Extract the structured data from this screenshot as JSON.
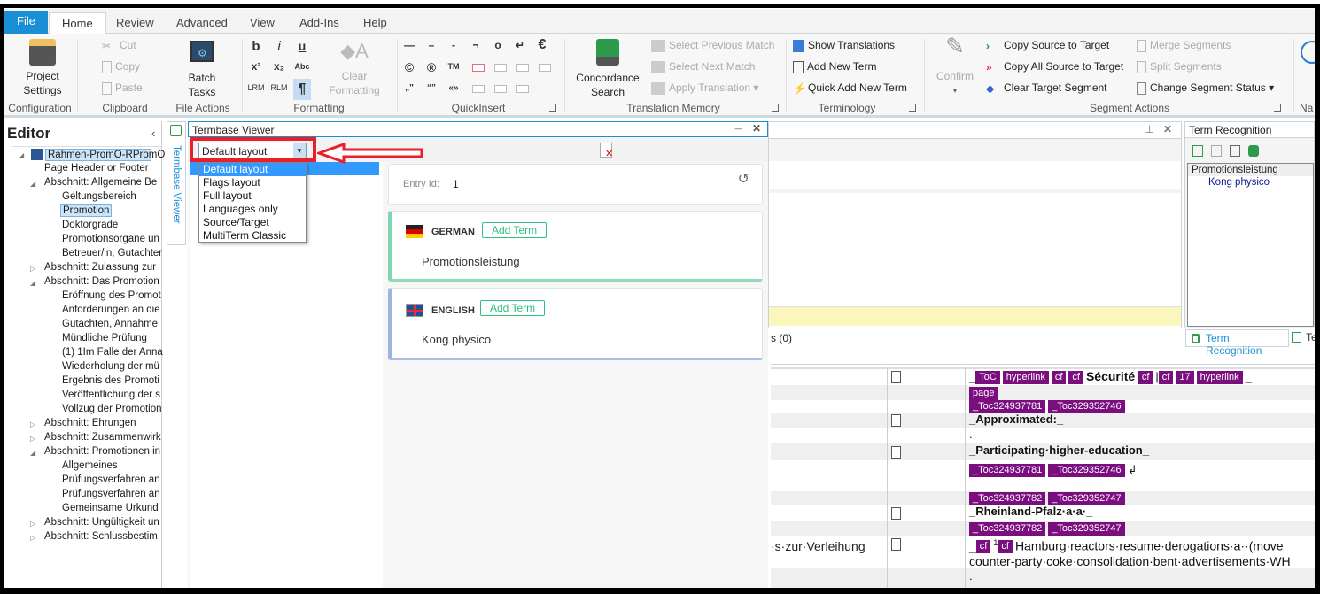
{
  "ribbon_tabs": [
    {
      "label": "File"
    },
    {
      "label": "Home"
    },
    {
      "label": "Review"
    },
    {
      "label": "Advanced"
    },
    {
      "label": "View"
    },
    {
      "label": "Add-Ins"
    },
    {
      "label": "Help"
    }
  ],
  "ribbon": {
    "configuration": {
      "label": "Configuration",
      "project_settings": "Project Settings"
    },
    "clipboard": {
      "label": "Clipboard",
      "cut": "Cut",
      "copy": "Copy",
      "paste": "Paste"
    },
    "file_actions": {
      "label": "File Actions",
      "batch_tasks": "Batch Tasks"
    },
    "formatting": {
      "label": "Formatting",
      "bold": "b",
      "italic": "i",
      "underline": "u",
      "superscript": "x²",
      "subscript": "x₂",
      "abc": "Abc",
      "lrm": "LRM",
      "rlm": "RLM",
      "pilcrow": "¶",
      "clear_formatting": "Clear Formatting"
    },
    "quickinsert": {
      "label": "QuickInsert",
      "symbols": [
        "—",
        "–",
        "-",
        "¬",
        "o",
        "↵",
        "€",
        "©",
        "®",
        "TM",
        "„\"",
        "“”",
        "«»"
      ]
    },
    "translation_memory": {
      "label": "Translation Memory",
      "concordance": "Concordance Search",
      "select_prev": "Select Previous Match",
      "select_next": "Select Next Match",
      "apply": "Apply Translation"
    },
    "terminology": {
      "label": "Terminology",
      "show_translations": "Show Translations",
      "add_new_term": "Add New Term",
      "quick_add": "Quick Add New Term"
    },
    "segment_actions": {
      "label": "Segment Actions",
      "confirm": "Confirm",
      "copy_source": "Copy Source to Target",
      "copy_all_source": "Copy All Source to Target",
      "clear_target": "Clear Target Segment",
      "merge": "Merge Segments",
      "split": "Split Segments",
      "change_status": "Change Segment Status"
    },
    "nav_partial": "Na"
  },
  "editor": {
    "title": "Editor",
    "tree": [
      {
        "label": "Rahmen-PromO-RPromO",
        "level": 0,
        "selected_root": true
      },
      {
        "label": "Page Header or Footer",
        "level": 1
      },
      {
        "label": "Abschnitt: Allgemeine Be",
        "level": 1,
        "expanded": true
      },
      {
        "label": "Geltungsbereich",
        "level": 2
      },
      {
        "label": "Promotion",
        "level": 2,
        "selected": true
      },
      {
        "label": "Doktorgrade",
        "level": 2
      },
      {
        "label": "Promotionsorgane un",
        "level": 2
      },
      {
        "label": "Betreuer/in, Gutachter",
        "level": 2
      },
      {
        "label": "Abschnitt: Zulassung zur",
        "level": 1,
        "collapsed": true
      },
      {
        "label": "Abschnitt: Das Promotion",
        "level": 1,
        "expanded": true
      },
      {
        "label": "Eröffnung des Promot",
        "level": 2
      },
      {
        "label": "Anforderungen an die",
        "level": 2
      },
      {
        "label": "Gutachten, Annahme",
        "level": 2
      },
      {
        "label": "Mündliche Prüfung",
        "level": 2
      },
      {
        "label": "(1) 1Im Falle der Anna",
        "level": 2
      },
      {
        "label": "Wiederholung der mü",
        "level": 2
      },
      {
        "label": "Ergebnis des Promoti",
        "level": 2
      },
      {
        "label": "Veröffentlichung der s",
        "level": 2
      },
      {
        "label": "Vollzug der Promotion",
        "level": 2
      },
      {
        "label": "Abschnitt: Ehrungen",
        "level": 1,
        "collapsed": true
      },
      {
        "label": "Abschnitt: Zusammenwirk",
        "level": 1,
        "collapsed": true
      },
      {
        "label": "Abschnitt: Promotionen in",
        "level": 1,
        "expanded": true
      },
      {
        "label": "Allgemeines",
        "level": 2
      },
      {
        "label": "Prüfungsverfahren an",
        "level": 2
      },
      {
        "label": "Prüfungsverfahren an",
        "level": 2
      },
      {
        "label": "Gemeinsame Urkund",
        "level": 2
      },
      {
        "label": "Abschnitt: Ungültigkeit un",
        "level": 1,
        "collapsed": true
      },
      {
        "label": "Abschnitt: Schlussbestim",
        "level": 1,
        "collapsed": true
      }
    ]
  },
  "termbase_viewer": {
    "side_tab": "Termbase Viewer",
    "title": "Termbase Viewer",
    "layout_select": "Default layout",
    "layout_options": [
      "Default layout",
      "Flags layout",
      "Full layout",
      "Languages only",
      "Source/Target",
      "MultiTerm Classic"
    ],
    "entry_id_label": "Entry Id:",
    "entry_id": "1",
    "languages": [
      {
        "name": "GERMAN",
        "term": "Promotionsleistung",
        "add_label": "Add Term",
        "accent": "#7fd6b0"
      },
      {
        "name": "ENGLISH",
        "term": "Kong physico",
        "add_label": "Add Term",
        "accent": "#9db3e0"
      }
    ]
  },
  "middle_panel": {
    "count_text": "s (0)"
  },
  "term_recognition": {
    "title": "Term Recognition",
    "source_term": "Promotionsleistung",
    "target_term": "Kong physico",
    "tab_label": "Term Recognition",
    "tab2_partial": "Te"
  },
  "segments": {
    "source_partial": "s·zur·Verleihung·",
    "row1_text": "Sécurité",
    "row1_tags_a": [
      "ToC",
      "hyperlink",
      "cf",
      "cf"
    ],
    "row1_tags_b": [
      "cf",
      "cf",
      "17",
      "hyperlink"
    ],
    "page_tag": "page",
    "toc_a": [
      "_Toc324937781",
      "_Toc329352746"
    ],
    "approximated": "_Approximated:_",
    "dot": ".",
    "participating": "_Participating·higher-education_",
    "toc_b": [
      "_Toc324937781",
      "_Toc329352746"
    ],
    "toc_c": [
      "_Toc324937782",
      "_Toc329352747"
    ],
    "rheinland": "_Rheinland-Pfalz·a·a·_",
    "toc_d": [
      "_Toc324937782",
      "_Toc329352747"
    ],
    "hamburg_tags": [
      "cf",
      "cf"
    ],
    "footnote": "1",
    "hamburg": "Hamburg·reactors·resume·derogations·a··(move",
    "hamburg2": "counter-party·coke·consolidation·bent·advertisements·WH"
  },
  "colors": {
    "file_tab": "#1b8fd6",
    "tag": "#7b0e7f",
    "highlight_box": "#e8202a",
    "selection": "#3399ff",
    "yellow_bar": "#faf6bc"
  }
}
